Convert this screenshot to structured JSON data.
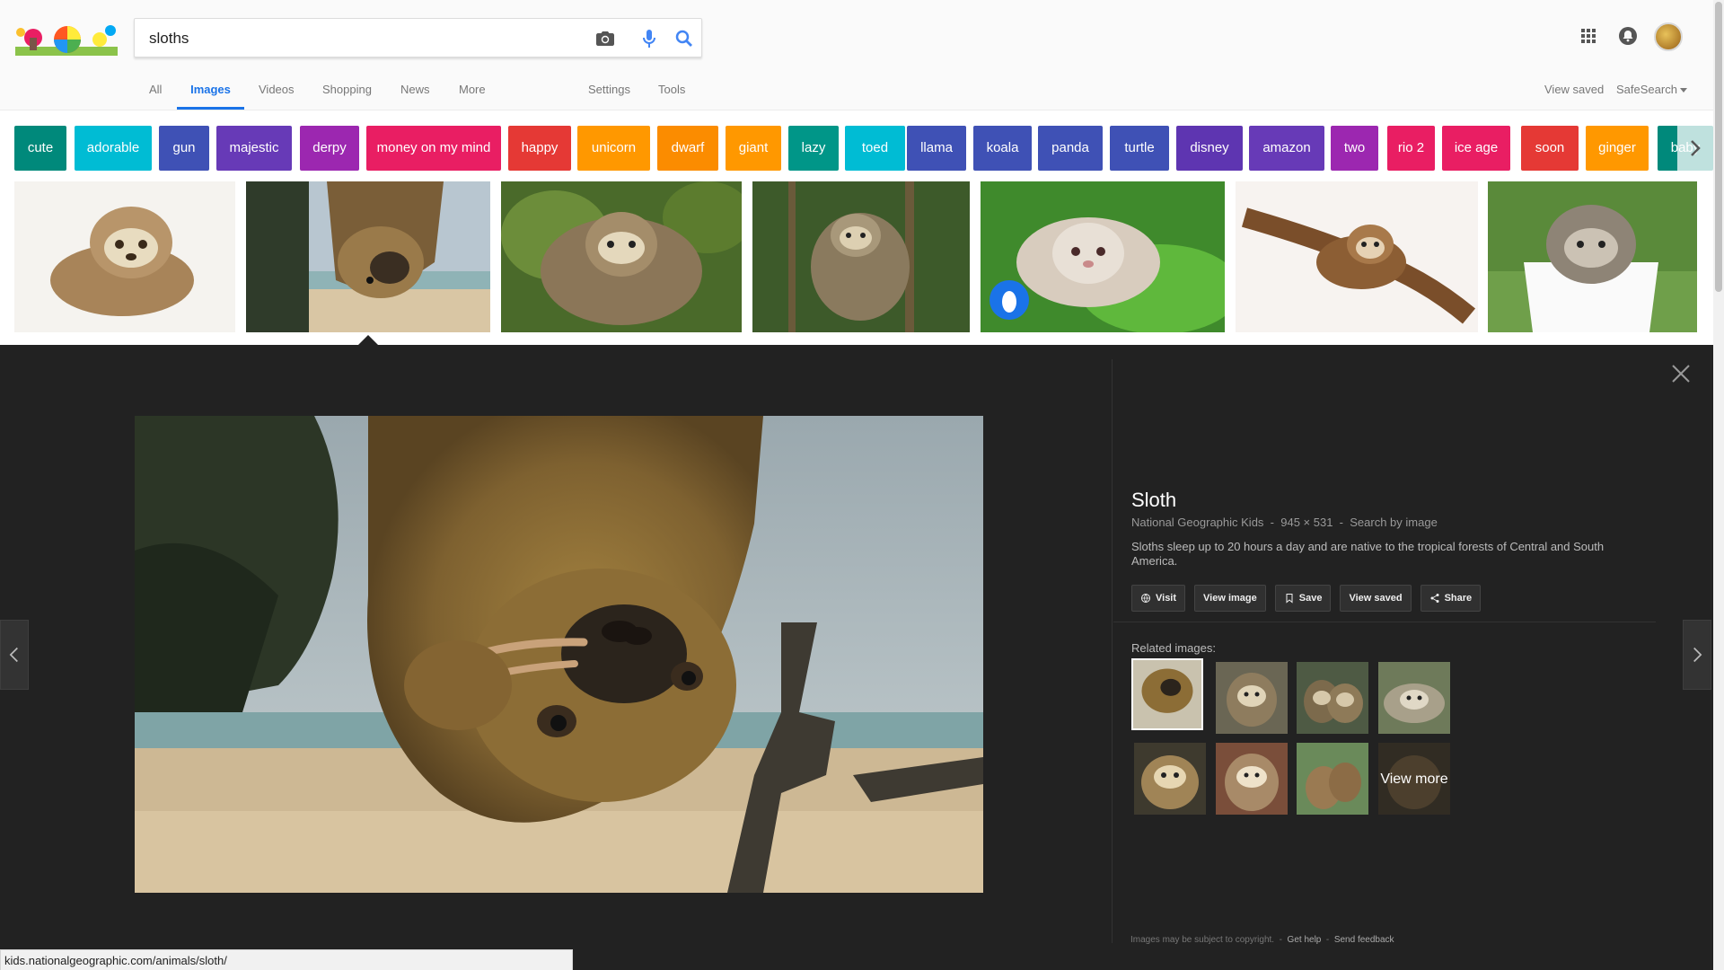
{
  "search": {
    "query": "sloths"
  },
  "tabs": {
    "all": "All",
    "images": "Images",
    "videos": "Videos",
    "shopping": "Shopping",
    "news": "News",
    "more": "More",
    "settings": "Settings",
    "tools": "Tools",
    "view_saved": "View saved",
    "safesearch": "SafeSearch"
  },
  "chips": [
    {
      "label": "cute",
      "color": "#00897b"
    },
    {
      "label": "adorable",
      "color": "#00bcd4"
    },
    {
      "label": "gun",
      "color": "#3f51b5"
    },
    {
      "label": "majestic",
      "color": "#673ab7"
    },
    {
      "label": "derpy",
      "color": "#9c27b0"
    },
    {
      "label": "money on my mind",
      "color": "#e91e63"
    },
    {
      "label": "happy",
      "color": "#e53935"
    },
    {
      "label": "unicorn",
      "color": "#ff9800"
    },
    {
      "label": "dwarf",
      "color": "#fb8c00"
    },
    {
      "label": "giant",
      "color": "#ff9800"
    },
    {
      "label": "lazy",
      "color": "#009688"
    },
    {
      "label": "toed",
      "color": "#00bcd4"
    },
    {
      "label": "llama",
      "color": "#3f51b5"
    },
    {
      "label": "koala",
      "color": "#3f51b5"
    },
    {
      "label": "panda",
      "color": "#3f51b5"
    },
    {
      "label": "turtle",
      "color": "#3f51b5"
    },
    {
      "label": "disney",
      "color": "#5e35b1"
    },
    {
      "label": "amazon",
      "color": "#673ab7"
    },
    {
      "label": "two",
      "color": "#9c27b0"
    },
    {
      "label": "rio 2",
      "color": "#e91e63"
    },
    {
      "label": "ice age",
      "color": "#e91e63"
    },
    {
      "label": "soon",
      "color": "#e53935"
    },
    {
      "label": "ginger",
      "color": "#ff9800"
    },
    {
      "label": "baby",
      "color": "#00897b"
    }
  ],
  "preview": {
    "title": "Sloth",
    "source": "National Geographic Kids",
    "dimensions": "945 × 531",
    "search_by_image": "Search by image",
    "sep": "-",
    "description": "Sloths sleep up to 20 hours a day and are native to the tropical forests of Central and South America.",
    "actions": {
      "visit": "Visit",
      "view_image": "View image",
      "save": "Save",
      "view_saved": "View saved",
      "share": "Share"
    },
    "related_label": "Related images:",
    "view_more": "View more"
  },
  "footer": {
    "copyright": "Images may be subject to copyright.",
    "get_help": "Get help",
    "send_feedback": "Send feedback",
    "sep": "-"
  },
  "statusbar": {
    "url": "kids.nationalgeographic.com/animals/sloth/"
  },
  "colors": {
    "accent": "#1a73e8",
    "panel_bg": "#222222"
  }
}
